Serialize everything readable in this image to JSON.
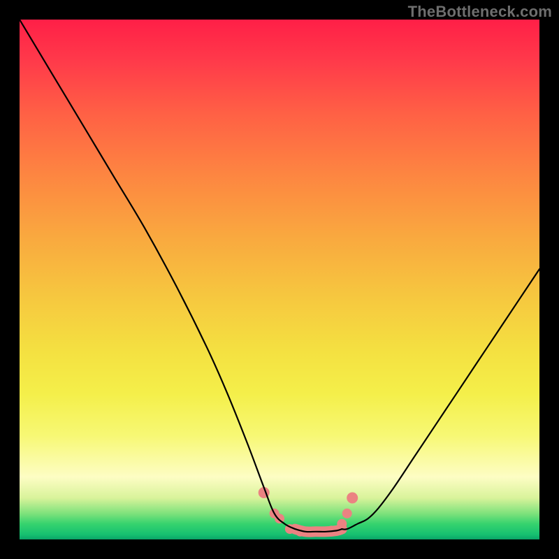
{
  "watermark": "TheBottleneck.com",
  "chart_data": {
    "type": "line",
    "title": "",
    "xlabel": "",
    "ylabel": "",
    "xlim": [
      0,
      100
    ],
    "ylim": [
      0,
      100
    ],
    "grid": false,
    "legend": false,
    "description": "Bottleneck-style V-curve on a vertical rainbow gradient (red at top through yellow to green at bottom). Two black curves descend from upper corners into a narrow flat valley near the bottom center; salmon-colored dots/blobs sit along the valley floor where the curves meet.",
    "series": [
      {
        "name": "left-curve",
        "x": [
          0,
          6,
          12,
          18,
          24,
          30,
          36,
          40,
          44,
          47,
          49,
          51,
          53
        ],
        "y": [
          100,
          90,
          80,
          70,
          60,
          49,
          37,
          28,
          18,
          10,
          5,
          3,
          2
        ]
      },
      {
        "name": "right-curve",
        "x": [
          100,
          96,
          92,
          88,
          84,
          80,
          76,
          72,
          69,
          67,
          65,
          63,
          62
        ],
        "y": [
          52,
          46,
          40,
          34,
          28,
          22,
          16,
          10,
          6,
          4,
          3,
          2,
          2
        ]
      },
      {
        "name": "valley-floor",
        "x": [
          53,
          55,
          57,
          59,
          61,
          62
        ],
        "y": [
          2,
          1.5,
          1.5,
          1.5,
          1.7,
          2
        ]
      }
    ],
    "markers": {
      "name": "valley-dots",
      "color": "#eb8282",
      "points_x": [
        47,
        49,
        50,
        52,
        54,
        56,
        58,
        60,
        62,
        63,
        64
      ],
      "points_y": [
        9,
        5,
        4,
        2,
        1.5,
        1.5,
        1.5,
        1.7,
        3,
        5,
        8
      ]
    }
  }
}
